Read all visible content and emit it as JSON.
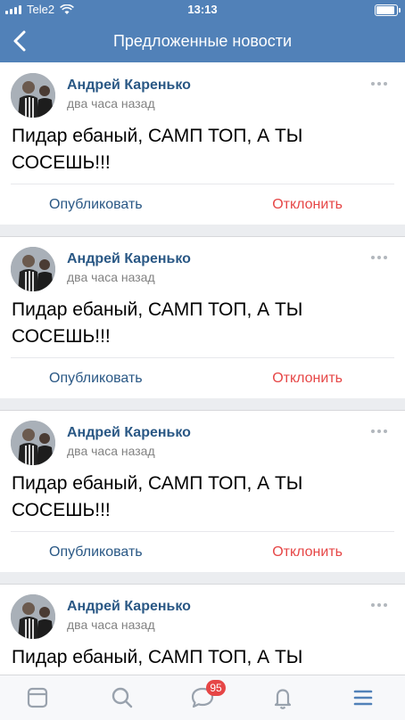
{
  "status_bar": {
    "carrier": "Tele2",
    "time": "13:13"
  },
  "header": {
    "title": "Предложенные новости"
  },
  "posts": [
    {
      "author": "Андрей Каренько",
      "time": "два часа назад",
      "text": "Пидар ебаный, САМП ТОП, А ТЫ СОСЕШЬ!!!",
      "publish_label": "Опубликовать",
      "reject_label": "Отклонить"
    },
    {
      "author": "Андрей Каренько",
      "time": "два часа назад",
      "text": "Пидар ебаный, САМП ТОП, А ТЫ СОСЕШЬ!!!",
      "publish_label": "Опубликовать",
      "reject_label": "Отклонить"
    },
    {
      "author": "Андрей Каренько",
      "time": "два часа назад",
      "text": "Пидар ебаный, САМП ТОП, А ТЫ СОСЕШЬ!!!",
      "publish_label": "Опубликовать",
      "reject_label": "Отклонить"
    },
    {
      "author": "Андрей Каренько",
      "time": "два часа назад",
      "text": "Пидар ебаный, САМП ТОП, А ТЫ",
      "publish_label": "",
      "reject_label": ""
    }
  ],
  "tabbar": {
    "items": [
      {
        "icon": "news-feed-icon"
      },
      {
        "icon": "search-icon"
      },
      {
        "icon": "messages-icon",
        "badge": "95"
      },
      {
        "icon": "bell-icon"
      },
      {
        "icon": "menu-icon"
      }
    ],
    "active_color": "#5181b8"
  }
}
